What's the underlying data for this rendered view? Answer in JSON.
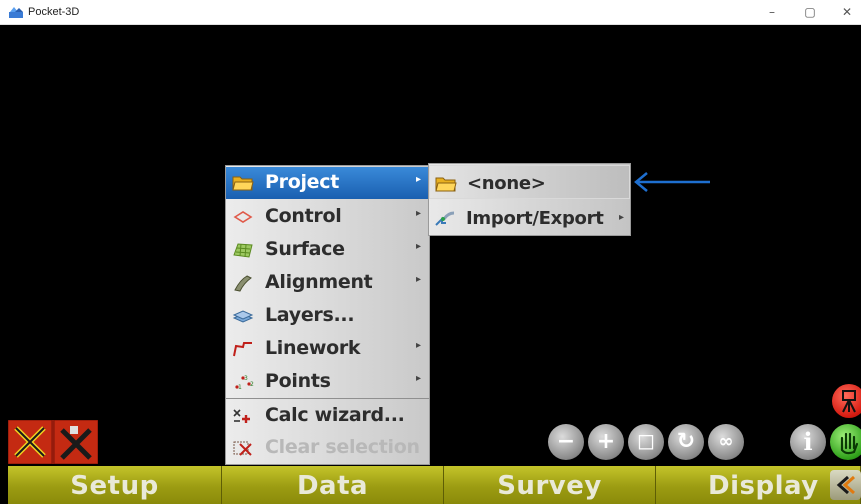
{
  "window": {
    "title": "Pocket-3D",
    "minimize_glyph": "–",
    "maximize_glyph": "▢",
    "close_glyph": "✕"
  },
  "main_menu": {
    "items": [
      {
        "label": "Project",
        "icon": "folder-icon",
        "has_submenu": true,
        "selected": true
      },
      {
        "label": "Control",
        "icon": "control-diamond-icon",
        "has_submenu": true
      },
      {
        "label": "Surface",
        "icon": "surface-grid-icon",
        "has_submenu": true
      },
      {
        "label": "Alignment",
        "icon": "alignment-icon",
        "has_submenu": true
      },
      {
        "label": "Layers...",
        "icon": "layers-icon",
        "has_submenu": false
      },
      {
        "label": "Linework",
        "icon": "linework-icon",
        "has_submenu": true
      },
      {
        "label": "Points",
        "icon": "points-icon",
        "has_submenu": true
      },
      {
        "label": "Calc wizard...",
        "icon": "calc-wizard-icon",
        "has_submenu": false
      },
      {
        "label": "Clear selection",
        "icon": "clear-selection-icon",
        "has_submenu": false,
        "disabled": true
      }
    ]
  },
  "submenu": {
    "items": [
      {
        "label": "<none>",
        "icon": "folder-icon",
        "has_submenu": false
      },
      {
        "label": "Import/Export",
        "icon": "import-export-icon",
        "has_submenu": true
      }
    ]
  },
  "toolbar": {
    "buttons": [
      {
        "name": "zoom-out",
        "glyph": "−"
      },
      {
        "name": "zoom-in",
        "glyph": "+"
      },
      {
        "name": "zoom-extents",
        "glyph": "◻"
      },
      {
        "name": "refresh",
        "glyph": "↻"
      },
      {
        "name": "infinite",
        "glyph": "∞"
      },
      {
        "name": "info",
        "glyph": "i"
      }
    ]
  },
  "tabs": [
    {
      "label": "Setup"
    },
    {
      "label": "Data"
    },
    {
      "label": "Survey"
    },
    {
      "label": "Display"
    }
  ],
  "colors": {
    "menu_highlight": "#1a5fb0",
    "tab_olive": "#9c9c12",
    "annotation_arrow": "#1e6fd0",
    "pan_green": "#2fa01a",
    "alert_red": "#d41a10"
  }
}
